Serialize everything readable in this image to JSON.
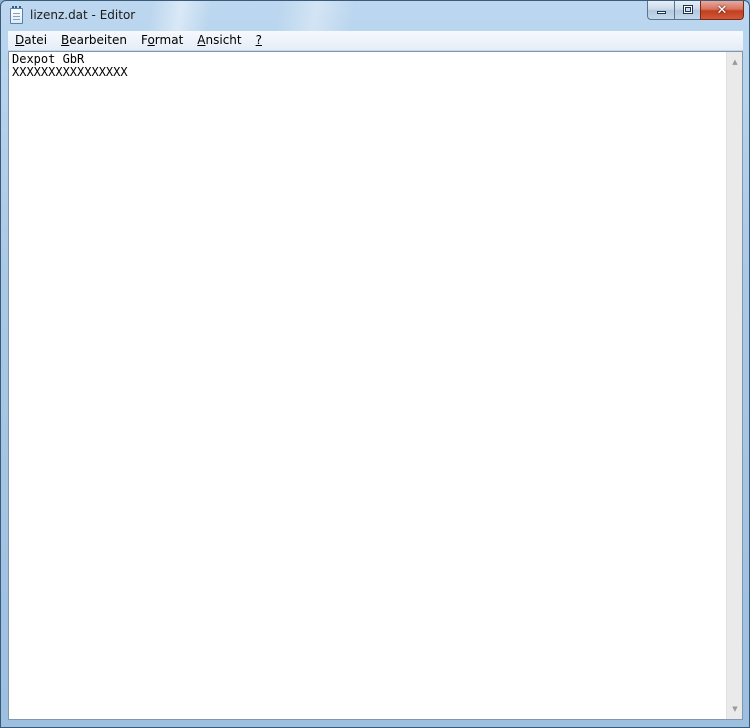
{
  "window": {
    "title": "lizenz.dat - Editor",
    "controls": {
      "minimize_icon": "minimize-icon",
      "maximize_icon": "maximize-icon",
      "close_icon": "close-icon",
      "close_glyph": "✕"
    }
  },
  "menu": {
    "items": [
      {
        "label_pre": "",
        "label_u": "D",
        "label_post": "atei"
      },
      {
        "label_pre": "",
        "label_u": "B",
        "label_post": "earbeiten"
      },
      {
        "label_pre": "F",
        "label_u": "o",
        "label_post": "rmat"
      },
      {
        "label_pre": "",
        "label_u": "A",
        "label_post": "nsicht"
      },
      {
        "label_pre": "",
        "label_u": "?",
        "label_post": ""
      }
    ]
  },
  "document": {
    "lines": [
      "Dexpot GbR",
      "XXXXXXXXXXXXXXXX"
    ]
  },
  "scrollbar": {
    "up_arrow": "▲",
    "down_arrow": "▼"
  },
  "colors": {
    "frame": "#a9c8e6",
    "close_button": "#c1401f",
    "text_background": "#ffffff"
  }
}
